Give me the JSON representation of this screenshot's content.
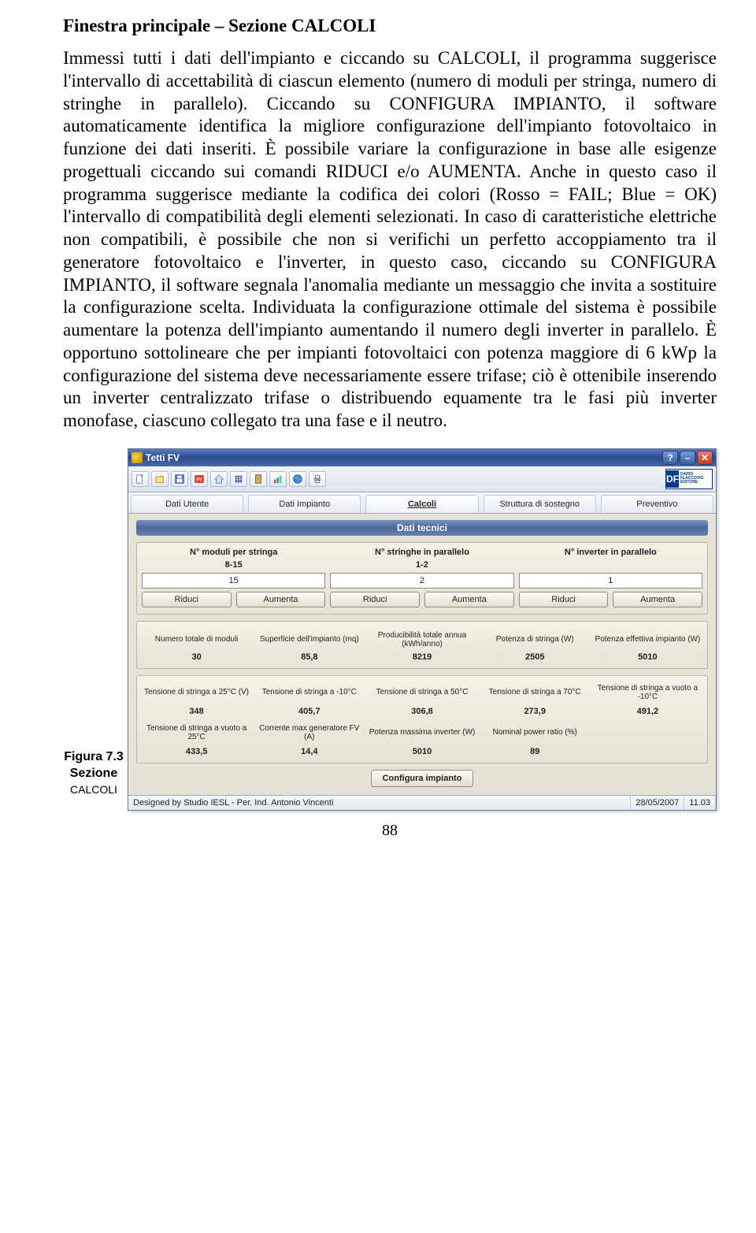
{
  "doc": {
    "heading": "Finestra principale – Sezione CALCOLI",
    "body": "Immessi tutti i dati dell'impianto e ciccando su CALCOLI, il programma suggerisce l'intervallo di accettabilità di ciascun elemento (numero di moduli per stringa, numero di stringhe in parallelo). Ciccando su CONFIGURA IMPIANTO, il software automaticamente identifica la migliore configurazione dell'impianto fotovoltaico in funzione dei dati inseriti. È possibile variare la configurazione in base alle esigenze progettuali ciccando sui comandi RIDUCI e/o AUMENTA. Anche in questo caso il programma suggerisce mediante la codifica dei colori (Rosso = FAIL; Blue = OK) l'intervallo di compatibilità degli elementi selezionati. In caso di caratteristiche elettriche non compatibili, è possibile che non si verifichi un perfetto accoppiamento tra il generatore fotovoltaico e l'inverter, in questo caso, ciccando su CONFIGURA IMPIANTO, il software segnala l'anomalia mediante un messaggio che invita a sostituire la configurazione scelta. Individuata la configurazione ottimale del sistema è possibile aumentare la potenza dell'impianto aumentando il numero degli inverter in parallelo. È opportuno sottolineare che per impianti fotovoltaici con potenza maggiore di 6 kWp la configurazione del sistema deve necessariamente essere trifase; ciò è ottenibile inserendo un inverter centralizzato trifase o distribuendo equamente tra le fasi più inverter monofase, ciascuno collegato tra una fase e il neutro.",
    "caption_line1": "Figura 7.3",
    "caption_line2": "Sezione",
    "caption_line3": "CALCOLI",
    "pagenum": "88"
  },
  "app": {
    "title": "Tetti FV",
    "logo_text": "DARIO FLACCOVIO EDITORE",
    "tabs": [
      "Dati Utente",
      "Dati Impianto",
      "Calcoli",
      "Struttura di sostegno",
      "Preventivo"
    ],
    "active_tab": 2,
    "banner": "Dati tecnici",
    "cols": [
      {
        "label": "N° moduli per stringa",
        "range": "8-15",
        "value": "15"
      },
      {
        "label": "N° stringhe in parallelo",
        "range": "1-2",
        "value": "2"
      },
      {
        "label": "N° inverter in parallelo",
        "range": "",
        "value": "1"
      }
    ],
    "btn_reduce": "Riduci",
    "btn_increase": "Aumenta",
    "outputs1": [
      {
        "h": "Numero totale di moduli",
        "v": "30"
      },
      {
        "h": "Superficie dell'impianto (mq)",
        "v": "85,8"
      },
      {
        "h": "Producibilità totale annua (kWh/anno)",
        "v": "8219"
      },
      {
        "h": "Potenza di stringa (W)",
        "v": "2505"
      },
      {
        "h": "Potenza effettiva impianto (W)",
        "v": "5010"
      }
    ],
    "outputs2": [
      {
        "h": "Tensione di stringa a 25°C (V)",
        "v": "348"
      },
      {
        "h": "Tensione di stringa a -10°C",
        "v": "405,7"
      },
      {
        "h": "Tensione di stringa a 50°C",
        "v": "306,8"
      },
      {
        "h": "Tensione di stringa a 70°C",
        "v": "273,9"
      },
      {
        "h": "Tensione di stringa a vuoto a -10°C",
        "v": "491,2"
      }
    ],
    "outputs3": [
      {
        "h": "Tensione di stringa a vuoto a 25°C",
        "v": "433,5"
      },
      {
        "h": "Corrente max generatore FV (A)",
        "v": "14,4"
      },
      {
        "h": "Potenza massima inverter (W)",
        "v": "5010"
      },
      {
        "h": "Nominal power ratio (%)",
        "v": "89"
      }
    ],
    "configure_btn": "Configura impianto",
    "status_design": "Designed by Studio IESL - Per. Ind. Antonio Vincenti",
    "status_date": "28/05/2007",
    "status_time": "11.03"
  }
}
